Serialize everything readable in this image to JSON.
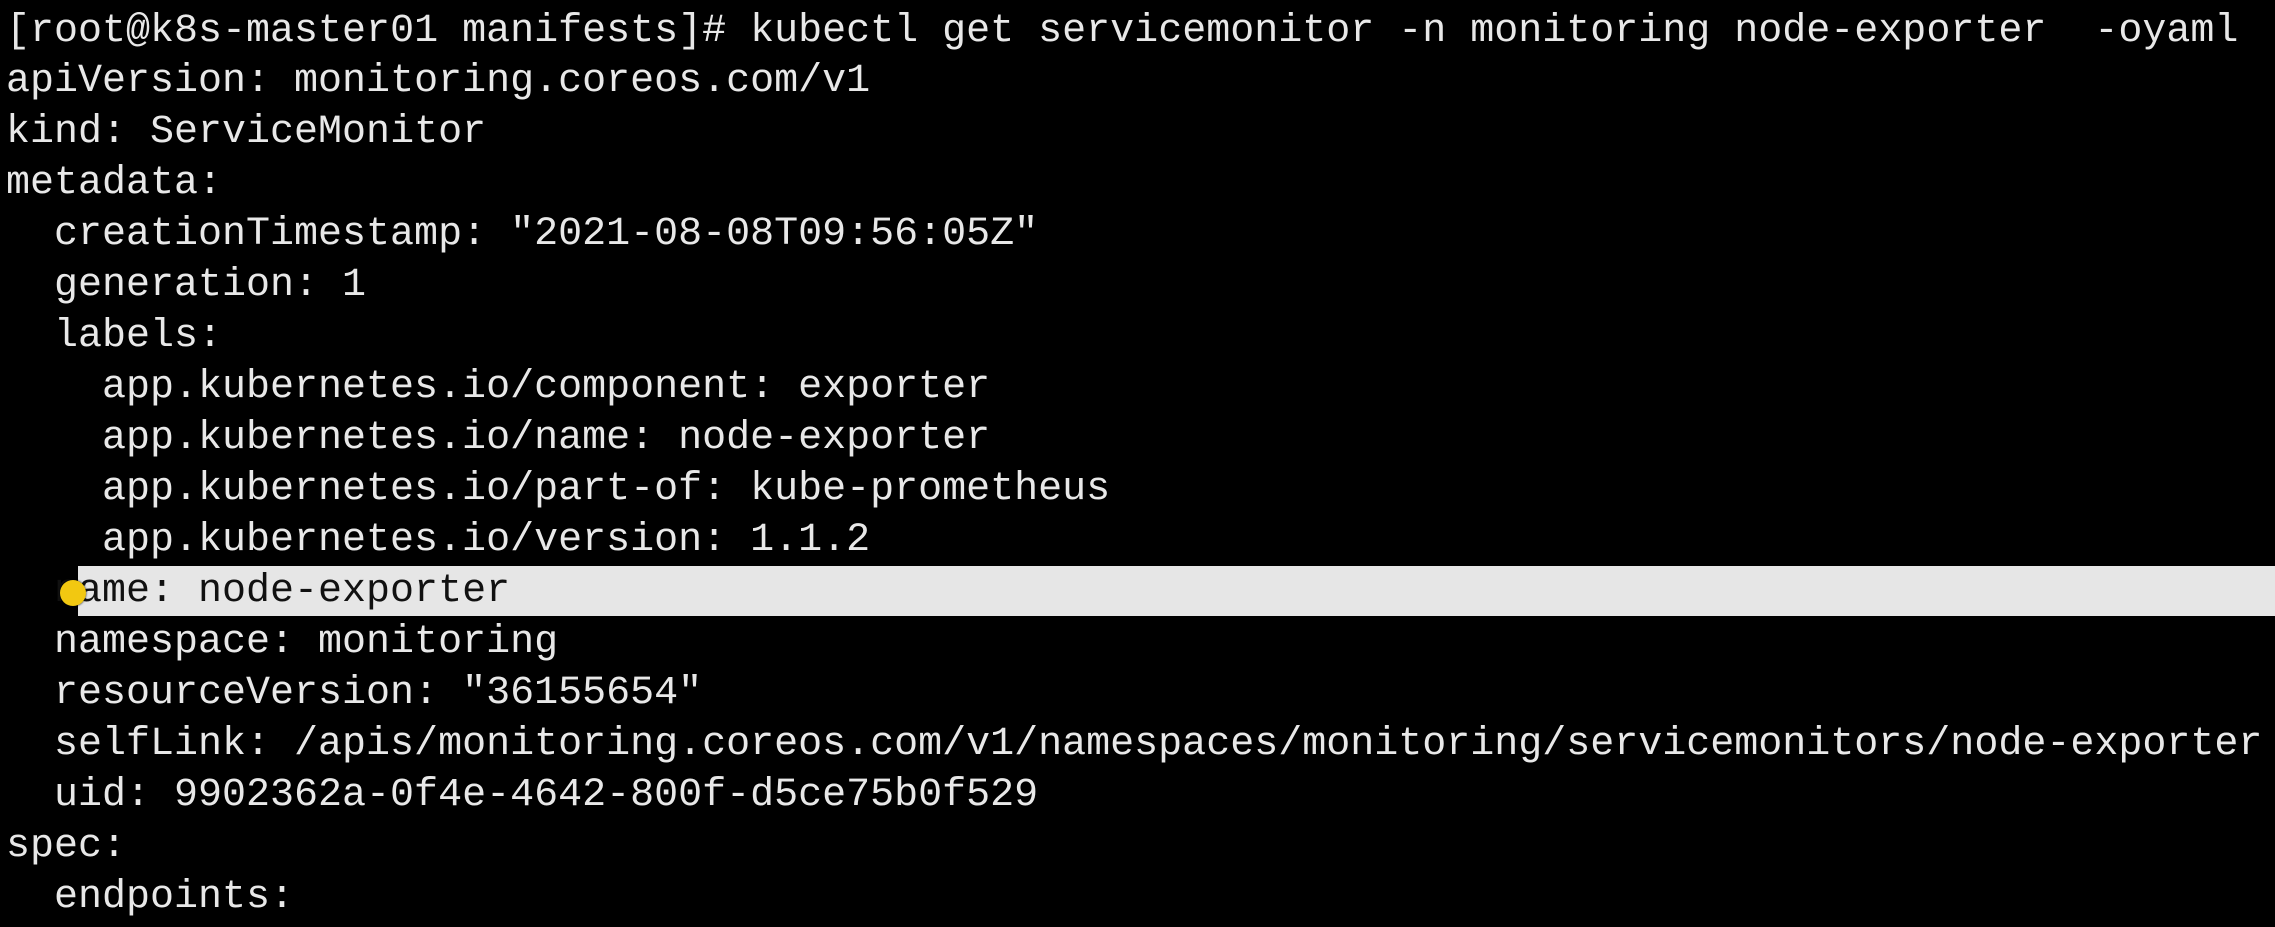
{
  "terminal": {
    "lines": [
      "[root@k8s-master01 manifests]# kubectl get servicemonitor -n monitoring node-exporter  -oyaml",
      "apiVersion: monitoring.coreos.com/v1",
      "kind: ServiceMonitor",
      "metadata:",
      "creationTimestamp: \"2021-08-08T09:56:05Z\"",
      "generation: 1",
      "labels:",
      "app.kubernetes.io/component: exporter",
      "app.kubernetes.io/name: node-exporter",
      "app.kubernetes.io/part-of: kube-prometheus",
      "app.kubernetes.io/version: 1.1.2",
      "name: node-exporter",
      "namespace: monitoring",
      "resourceVersion: \"36155654\"",
      "selfLink: /apis/monitoring.coreos.com/v1/namespaces/monitoring/servicemonitors/node-exporter",
      "uid: 9902362a-0f4e-4642-800f-d5ce75b0f529",
      "spec:",
      "endpoints:"
    ]
  },
  "colors": {
    "background": "#000000",
    "text": "#e8e8e8",
    "selection": "#e6e6e6",
    "cursor": "#f2c811"
  },
  "icons": {
    "pointer": "mouse-cursor-highlight-icon"
  }
}
